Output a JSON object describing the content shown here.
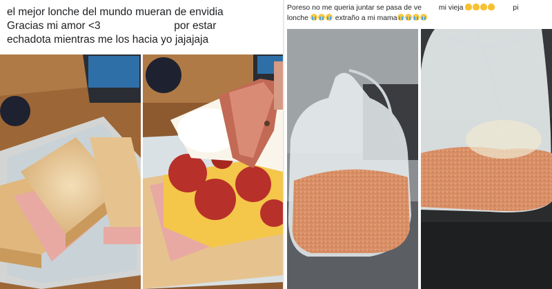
{
  "left_post": {
    "caption_lines": [
      "el mejor lonche del mundo mueran de envidia",
      "Gracias mi amor <3",
      "por estar",
      "echadota mientras me los hacia yo jajajaja"
    ]
  },
  "right_post": {
    "caption_part_1": "Poreso no me queria juntar se pasa de ve",
    "caption_part_2": " mi vieja ",
    "caption_part_3": " pi",
    "caption_part_4": "lonche ",
    "caption_part_5": " extraño a mi mama",
    "emoji_names": [
      "clapping-hands-emoji",
      "crying-face-emoji"
    ]
  },
  "photos": [
    {
      "name": "sandwich-container-photo",
      "subject": "toasted sandwiches in plastic container"
    },
    {
      "name": "sandwich-pepperoni-egg-photo",
      "subject": "sandwich with ham, pepperoni, cheese, egg and bacon"
    },
    {
      "name": "rice-bag-photo",
      "subject": "plastic bag of red rice"
    },
    {
      "name": "rice-bag-closeup-photo",
      "subject": "closeup of plastic bag of red rice"
    }
  ],
  "colors": {
    "wood": "#a06a3a",
    "container": "#dfe6ea",
    "bread": "#e8c48c",
    "ham": "#e8a9a3",
    "pepperoni": "#b8302a",
    "cheese": "#f4c64a",
    "rice": "#d98f66",
    "bag": "#e9eef0"
  }
}
